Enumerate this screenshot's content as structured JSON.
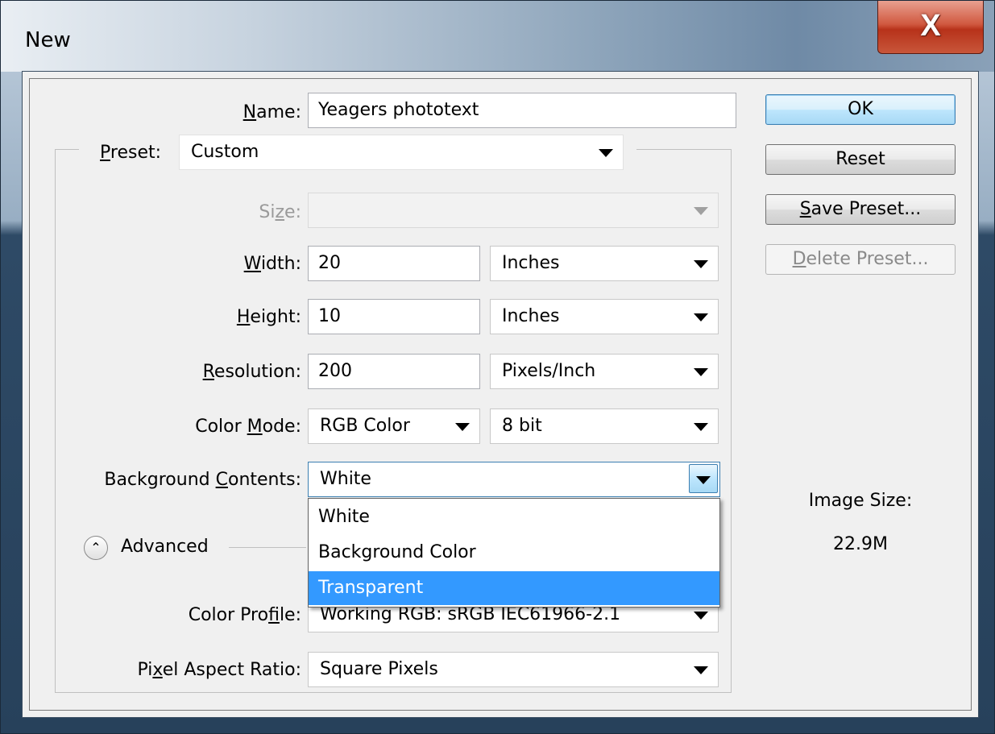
{
  "window": {
    "title": "New",
    "close_glyph": "X"
  },
  "form": {
    "name": {
      "label_prefix": "",
      "label_u": "N",
      "label_rest": "ame:",
      "value": "Yeagers phototext"
    },
    "preset": {
      "label_u": "P",
      "label_rest": "reset:",
      "value": "Custom"
    },
    "size": {
      "label_pre": "Si",
      "label_u": "z",
      "label_rest": "e:",
      "value": ""
    },
    "width": {
      "label_u": "W",
      "label_rest": "idth:",
      "value": "20",
      "unit": "Inches"
    },
    "height": {
      "label_u": "H",
      "label_rest": "eight:",
      "value": "10",
      "unit": "Inches"
    },
    "resolution": {
      "label_u": "R",
      "label_rest": "esolution:",
      "value": "200",
      "unit": "Pixels/Inch"
    },
    "color_mode": {
      "label_pre": "Color ",
      "label_u": "M",
      "label_rest": "ode:",
      "value": "RGB Color",
      "depth": "8 bit"
    },
    "background": {
      "label_pre": "Background ",
      "label_u": "C",
      "label_rest": "ontents:",
      "value": "White",
      "options": [
        "White",
        "Background Color",
        "Transparent"
      ],
      "highlighted": "Transparent"
    },
    "advanced": {
      "label": "Advanced",
      "icon": "double-chevron-up-icon"
    },
    "color_profile": {
      "label_pre": "Color Pro",
      "label_u": "f",
      "label_rest": "ile:",
      "value": "Working RGB:  sRGB IEC61966-2.1"
    },
    "pixel_aspect": {
      "label_pre": "Pi",
      "label_u": "x",
      "label_rest": "el Aspect Ratio:",
      "value": "Square Pixels"
    }
  },
  "buttons": {
    "ok": "OK",
    "reset": "Reset",
    "save_preset": {
      "u": "S",
      "rest": "ave Preset..."
    },
    "delete_preset": {
      "u": "D",
      "rest": "elete Preset..."
    }
  },
  "image_size": {
    "label": "Image Size:",
    "value": "22.9M"
  },
  "colors": {
    "selection": "#3399ff",
    "default_button": "#a7d9f5",
    "close_button": "#c8563a"
  }
}
